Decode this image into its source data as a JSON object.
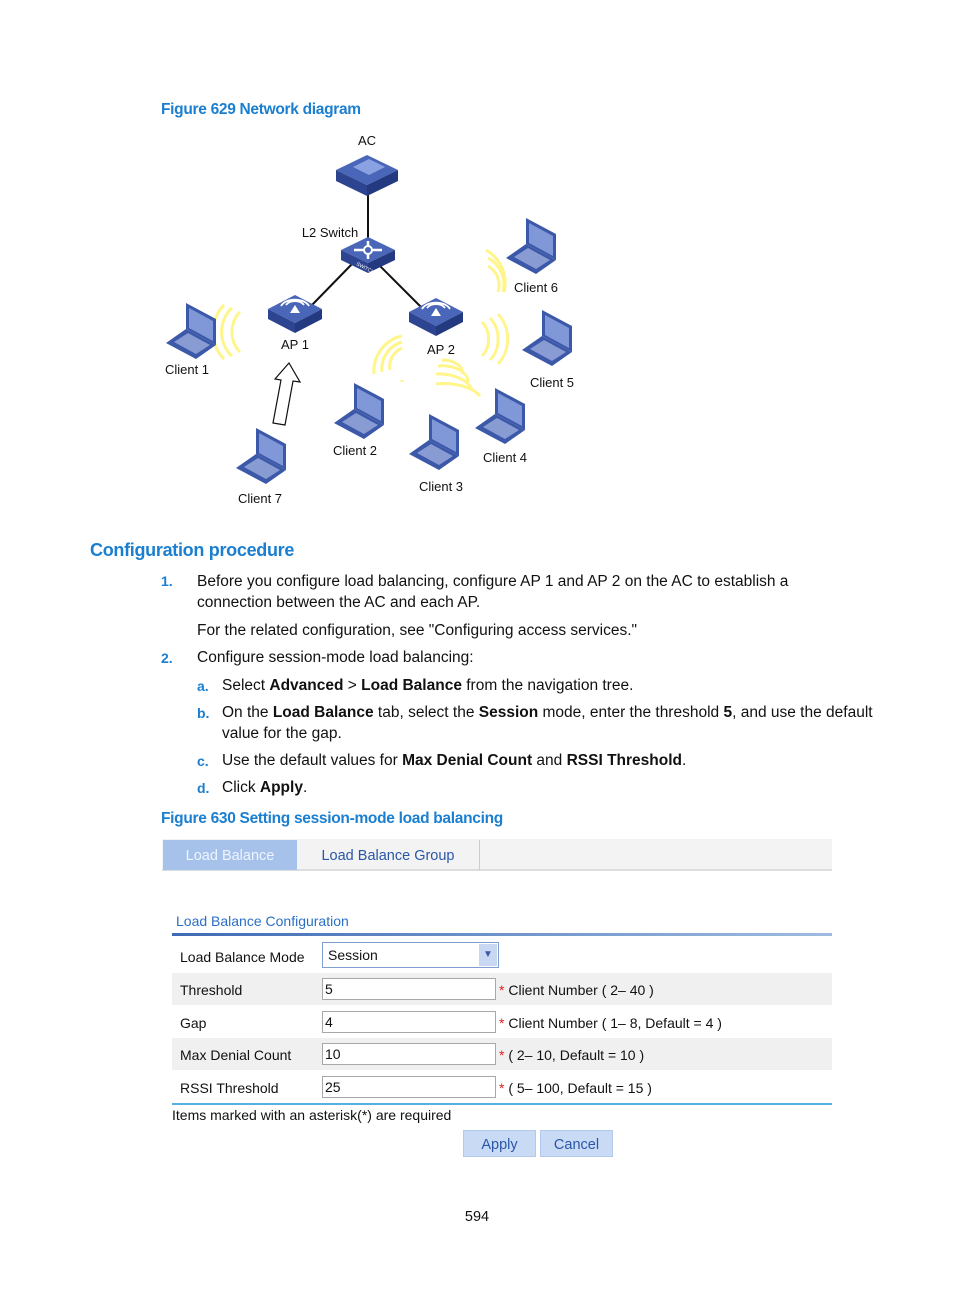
{
  "figure629": {
    "caption": "Figure 629 Network diagram",
    "nodes": {
      "ac": "AC",
      "switch": "L2 Switch",
      "switch_plate": "SWITCH",
      "ap1": "AP 1",
      "ap2": "AP 2",
      "client1": "Client 1",
      "client2": "Client 2",
      "client3": "Client 3",
      "client4": "Client 4",
      "client5": "Client 5",
      "client6": "Client 6",
      "client7": "Client 7"
    },
    "colors": {
      "device": "#3c58a8",
      "screen": "#7f95d6",
      "wave": "#fff58a"
    }
  },
  "section": {
    "title": "Configuration procedure"
  },
  "steps": [
    {
      "num": "1.",
      "text_a": "Before you configure load balancing, configure AP 1 and AP 2 on the AC to establish a",
      "text_b": "connection between the AC and each AP.",
      "note": "For the related configuration, see \"Configuring access services.\""
    },
    {
      "num": "2.",
      "text": "Configure session-mode load balancing:"
    }
  ],
  "substeps": {
    "a": {
      "num": "a.",
      "t1": "Select ",
      "b1": "Advanced",
      "t2": " > ",
      "b2": "Load Balance",
      "t3": " from the navigation tree."
    },
    "b": {
      "num": "b.",
      "t1": "On the ",
      "b1": "Load Balance",
      "t2": " tab, select the ",
      "b2": "Session",
      "t3": " mode, enter the threshold ",
      "b3": "5",
      "t4": ", and use the default",
      "t5": "value for the gap."
    },
    "c": {
      "num": "c.",
      "t1": "Use the default values for ",
      "b1": "Max Denial Count",
      "t2": " and ",
      "b2": "RSSI Threshold",
      "t3": "."
    },
    "d": {
      "num": "d.",
      "t1": "Click ",
      "b1": "Apply",
      "t2": "."
    }
  },
  "figure630": {
    "caption": "Figure 630 Setting session-mode load balancing",
    "tabs": [
      {
        "label": "Load Balance",
        "active": true
      },
      {
        "label": "Load Balance Group",
        "active": false
      }
    ],
    "section_title": "Load Balance Configuration",
    "mode": {
      "label": "Load Balance Mode",
      "value": "Session"
    },
    "fields": [
      {
        "label": "Threshold",
        "value": "5",
        "hint": "Client Number ( 2– 40 )"
      },
      {
        "label": "Gap",
        "value": "4",
        "hint": "Client Number ( 1– 8, Default = 4 )"
      },
      {
        "label": "Max Denial Count",
        "value": "10",
        "hint": "( 2– 10, Default = 10 )"
      },
      {
        "label": "RSSI Threshold",
        "value": "25",
        "hint": "( 5– 100, Default = 15 )"
      }
    ],
    "required_note": "Items marked with an asterisk(*) are required",
    "asterisk": "*",
    "apply": "Apply",
    "cancel": "Cancel"
  },
  "page_number": "594"
}
